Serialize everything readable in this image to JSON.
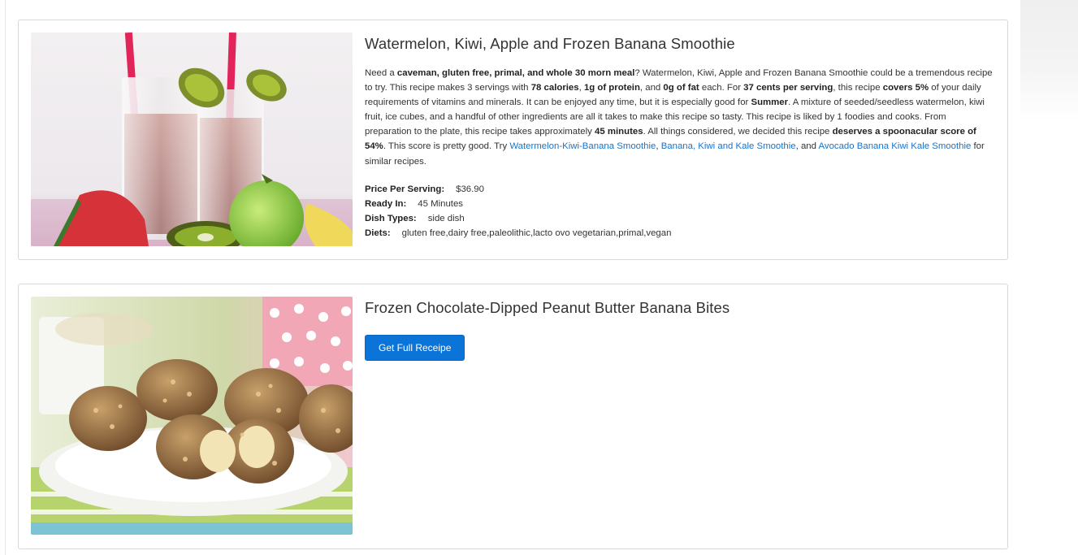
{
  "recipes": [
    {
      "title": "Watermelon, Kiwi, Apple and Frozen Banana Smoothie",
      "image_alt": "Watermelon Kiwi smoothie in two glasses",
      "summary": {
        "t1": "Need a ",
        "b1": "caveman, gluten free, primal, and whole 30 morn meal",
        "t2": "? Watermelon, Kiwi, Apple and Frozen Banana Smoothie could be a tremendous recipe to try. This recipe makes 3 servings with ",
        "b2": "78 calories",
        "t3": ", ",
        "b3": "1g of protein",
        "t4": ", and ",
        "b4": "0g of fat",
        "t5": " each. For ",
        "b5": "37 cents per serving",
        "t6": ", this recipe ",
        "b6": "covers 5%",
        "t7": " of your daily requirements of vitamins and minerals. It can be enjoyed any time, but it is especially good for ",
        "b7": "Summer",
        "t8": ". A mixture of seeded/seedless watermelon, kiwi fruit, ice cubes, and a handful of other ingredients are all it takes to make this recipe so tasty. This recipe is liked by 1 foodies and cooks. From preparation to the plate, this recipe takes approximately ",
        "b8": "45 minutes",
        "t9": ". All things considered, we decided this recipe ",
        "b9": "deserves a spoonacular score of 54%",
        "t10": ". This score is pretty good. Try ",
        "link1": "Watermelon-Kiwi-Banana Smoothie",
        "t11": ", ",
        "link2": "Banana, Kiwi and Kale Smoothie",
        "t12": ", and ",
        "link3": "Avocado Banana Kiwi Kale Smoothie",
        "t13": " for similar recipes."
      },
      "meta": [
        {
          "key": "Price Per Serving:",
          "value": "$36.90"
        },
        {
          "key": "Ready In:",
          "value": "45 Minutes"
        },
        {
          "key": "Dish Types:",
          "value": "side dish"
        },
        {
          "key": "Diets:",
          "value": "gluten free,dairy free,paleolithic,lacto ovo vegetarian,primal,vegan"
        }
      ]
    },
    {
      "title": "Frozen Chocolate-Dipped Peanut Butter Banana Bites",
      "image_alt": "Chocolate dipped banana bites on a plate",
      "button_label": "Get Full Receipe"
    }
  ],
  "colors": {
    "accent": "#0a74d8",
    "link": "#1a73c8",
    "border": "#d9d9d9"
  }
}
